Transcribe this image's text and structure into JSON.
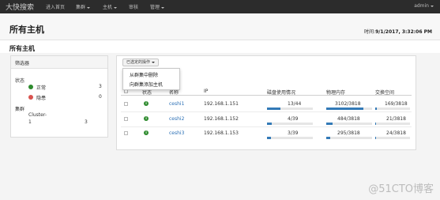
{
  "nav": {
    "brand": "大快搜索",
    "items": [
      "进入首页",
      "集群",
      "主机",
      "审核",
      "管理"
    ],
    "user": "admin"
  },
  "header": {
    "title": "所有主机",
    "time_label": "时间:",
    "time_value": "9/1/2017, 3:32:06 PM"
  },
  "section_title": "所有主机",
  "filter": {
    "heading": "筛选器",
    "status_label": "状态",
    "normal_label": "正常",
    "normal_count": "3",
    "hidden_label": "隐患",
    "hidden_count": "0",
    "cluster_label": "集群",
    "cluster_name": "Cluster-",
    "cluster_num": "1",
    "cluster_count": "3"
  },
  "actions": {
    "button_label": "已选定的操作",
    "menu": [
      "从群集中删除",
      "向群集添加主机"
    ]
  },
  "table": {
    "headers": [
      "状态",
      "名称",
      "IP",
      "磁盘使用情况",
      "物理内存",
      "交换空间"
    ],
    "rows": [
      {
        "name": "ceshi1",
        "ip": "192.168.1.151",
        "disk": "13/44",
        "disk_frac": 0.3,
        "memory": "3102/3818",
        "memory_frac": 0.81,
        "swap": "169/3818",
        "swap_frac": 0.05
      },
      {
        "name": "ceshi2",
        "ip": "192.168.1.152",
        "disk": "4/39",
        "disk_frac": 0.1,
        "memory": "484/3818",
        "memory_frac": 0.13,
        "swap": "21/3818",
        "swap_frac": 0.01
      },
      {
        "name": "ceshi3",
        "ip": "192.168.1.153",
        "disk": "3/39",
        "disk_frac": 0.08,
        "memory": "295/3818",
        "memory_frac": 0.08,
        "swap": "24/3818",
        "swap_frac": 0.01
      }
    ]
  },
  "watermark": "@51CTO博客",
  "colors": {
    "accent": "#337ab7",
    "status_ok": "#2e8b2e",
    "status_warn": "#d9534f",
    "link": "#2a6fb5"
  }
}
